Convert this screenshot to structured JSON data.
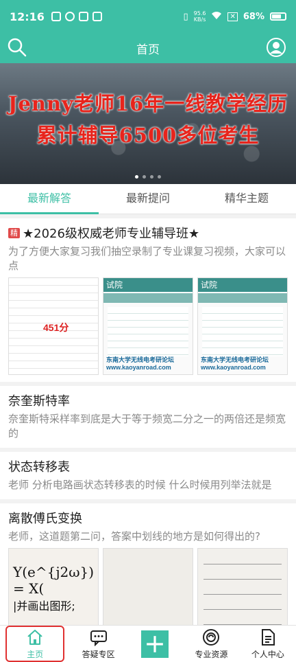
{
  "status_bar": {
    "time": "12:16",
    "net_speed_value": "95.6",
    "net_speed_unit": "KB/s",
    "battery": "68%"
  },
  "header": {
    "title": "首页"
  },
  "banner": {
    "line1": "Jenny老师16年一线教学经历",
    "line2": "累计辅导6500多位考生"
  },
  "tabs": [
    {
      "label": "最新解答",
      "active": true
    },
    {
      "label": "最新提问",
      "active": false
    },
    {
      "label": "精华主题",
      "active": false
    }
  ],
  "feed": [
    {
      "badge": "精",
      "title": "★2026级权威老师专业辅导班★",
      "desc": "为了方便大家复习我们抽空录制了专业课复习视频，大家可以点",
      "thumbs": {
        "score": "451分",
        "watermark": "东南大学无线电考研论坛 www.kaoyanroad.com",
        "form_header": "试院"
      }
    },
    {
      "title": "奈奎斯特率",
      "desc": "奈奎斯特采样率到底是大于等于频宽二分之一的两倍还是频宽的"
    },
    {
      "title": "状态转移表",
      "desc": "老师 分析电路画状态转移表的时候 什么时候用列举法就是"
    },
    {
      "title": "离散傅氏变换",
      "desc": "老师，这道题第二问，答案中划线的地方是如何得出的?",
      "thumbs": {
        "eq": "Y(e^{j2ω}) = X(",
        "text": "|并画出图形;"
      }
    }
  ],
  "bottom_nav": [
    {
      "label": "主页",
      "icon": "home-icon",
      "active": true
    },
    {
      "label": "答疑专区",
      "icon": "chat-icon",
      "active": false
    },
    {
      "label": "",
      "icon": "plus-icon",
      "active": false
    },
    {
      "label": "专业资源",
      "icon": "resource-icon",
      "active": false
    },
    {
      "label": "个人中心",
      "icon": "document-icon",
      "active": false
    }
  ],
  "colors": {
    "accent": "#3dbfa5",
    "banner_text": "#e8241c",
    "badge": "#e04a4a"
  }
}
